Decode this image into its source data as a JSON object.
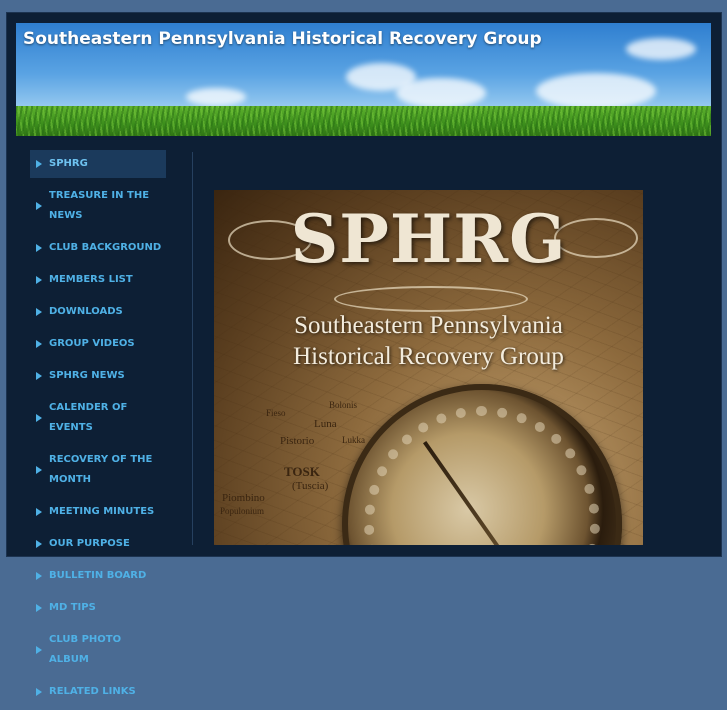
{
  "site": {
    "title": "Southeastern Pennsylvania Historical Recovery Group"
  },
  "nav": {
    "items": [
      {
        "label": "SPHRG",
        "active": true
      },
      {
        "label": "TREASURE IN THE NEWS"
      },
      {
        "label": "CLUB BACKGROUND"
      },
      {
        "label": "MEMBERS LIST"
      },
      {
        "label": "DOWNLOADS"
      },
      {
        "label": "GROUP VIDEOS"
      },
      {
        "label": "SPHRG NEWS"
      },
      {
        "label": "CALENDER OF EVENTS"
      },
      {
        "label": "RECOVERY OF THE MONTH"
      },
      {
        "label": "MEETING MINUTES"
      },
      {
        "label": "OUR PURPOSE"
      },
      {
        "label": "BULLETIN BOARD"
      },
      {
        "label": "MD TIPS"
      },
      {
        "label": "CLUB PHOTO ALBUM"
      },
      {
        "label": "RELATED LINKS"
      }
    ]
  },
  "hero": {
    "logo": "SPHRG",
    "line1": "Southeastern Pennsylvania",
    "line2": "Historical Recovery Group",
    "map_labels": [
      "Luna",
      "Pistorio",
      "TOSK",
      "(Tuscia)",
      "Piombino",
      "Populonium",
      "Bolonis",
      "Fieso",
      "Lukka"
    ]
  },
  "colors": {
    "background": "#4a6b93",
    "frame": "#0d1f35",
    "nav_link": "#4fb1e6",
    "nav_active_bg": "#1b3a5c",
    "title": "#ffffff"
  }
}
